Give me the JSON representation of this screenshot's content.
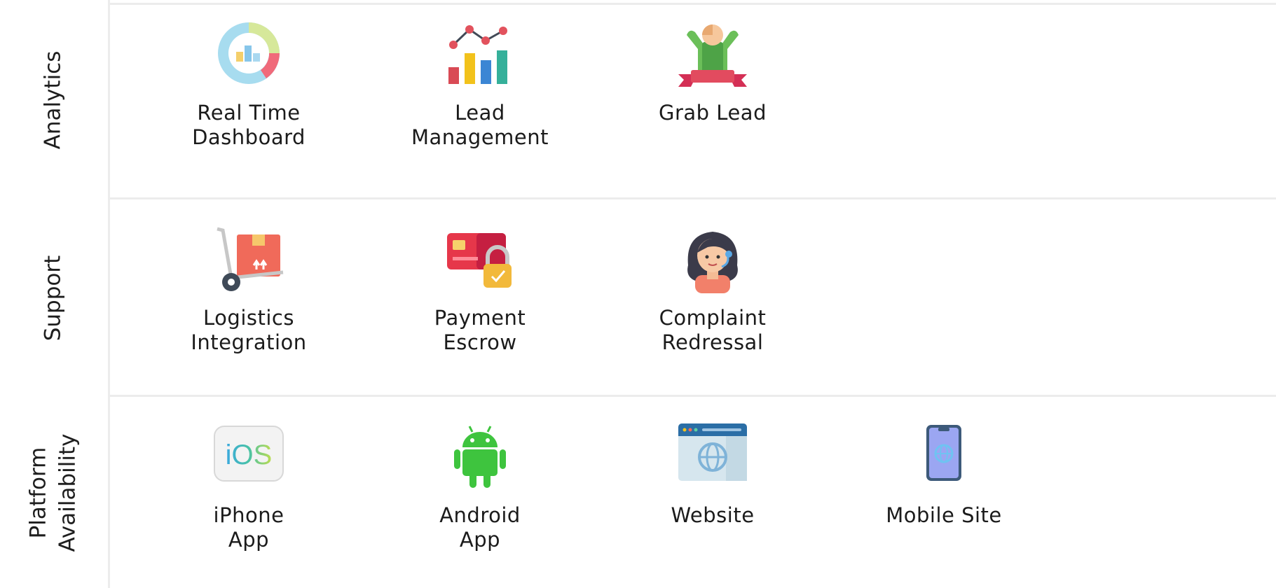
{
  "sections": [
    {
      "title": "Analytics",
      "items": [
        {
          "label": "Real Time\nDashboard",
          "icon": "dashboard-gauge-icon"
        },
        {
          "label": "Lead\nManagement",
          "icon": "bar-line-chart-icon"
        },
        {
          "label": "Grab Lead",
          "icon": "winner-ribbon-icon"
        }
      ]
    },
    {
      "title": "Support",
      "items": [
        {
          "label": "Logistics\nIntegration",
          "icon": "hand-truck-box-icon"
        },
        {
          "label": "Payment\nEscrow",
          "icon": "card-lock-icon"
        },
        {
          "label": "Complaint\nRedressal",
          "icon": "support-agent-icon"
        }
      ]
    },
    {
      "title": "Platform\nAvailability",
      "items": [
        {
          "label": "iPhone\nApp",
          "icon": "ios-icon",
          "icon_text": "iOS"
        },
        {
          "label": "Android\nApp",
          "icon": "android-icon"
        },
        {
          "label": "Website",
          "icon": "browser-globe-icon"
        },
        {
          "label": "Mobile Site",
          "icon": "mobile-globe-icon"
        }
      ]
    }
  ]
}
